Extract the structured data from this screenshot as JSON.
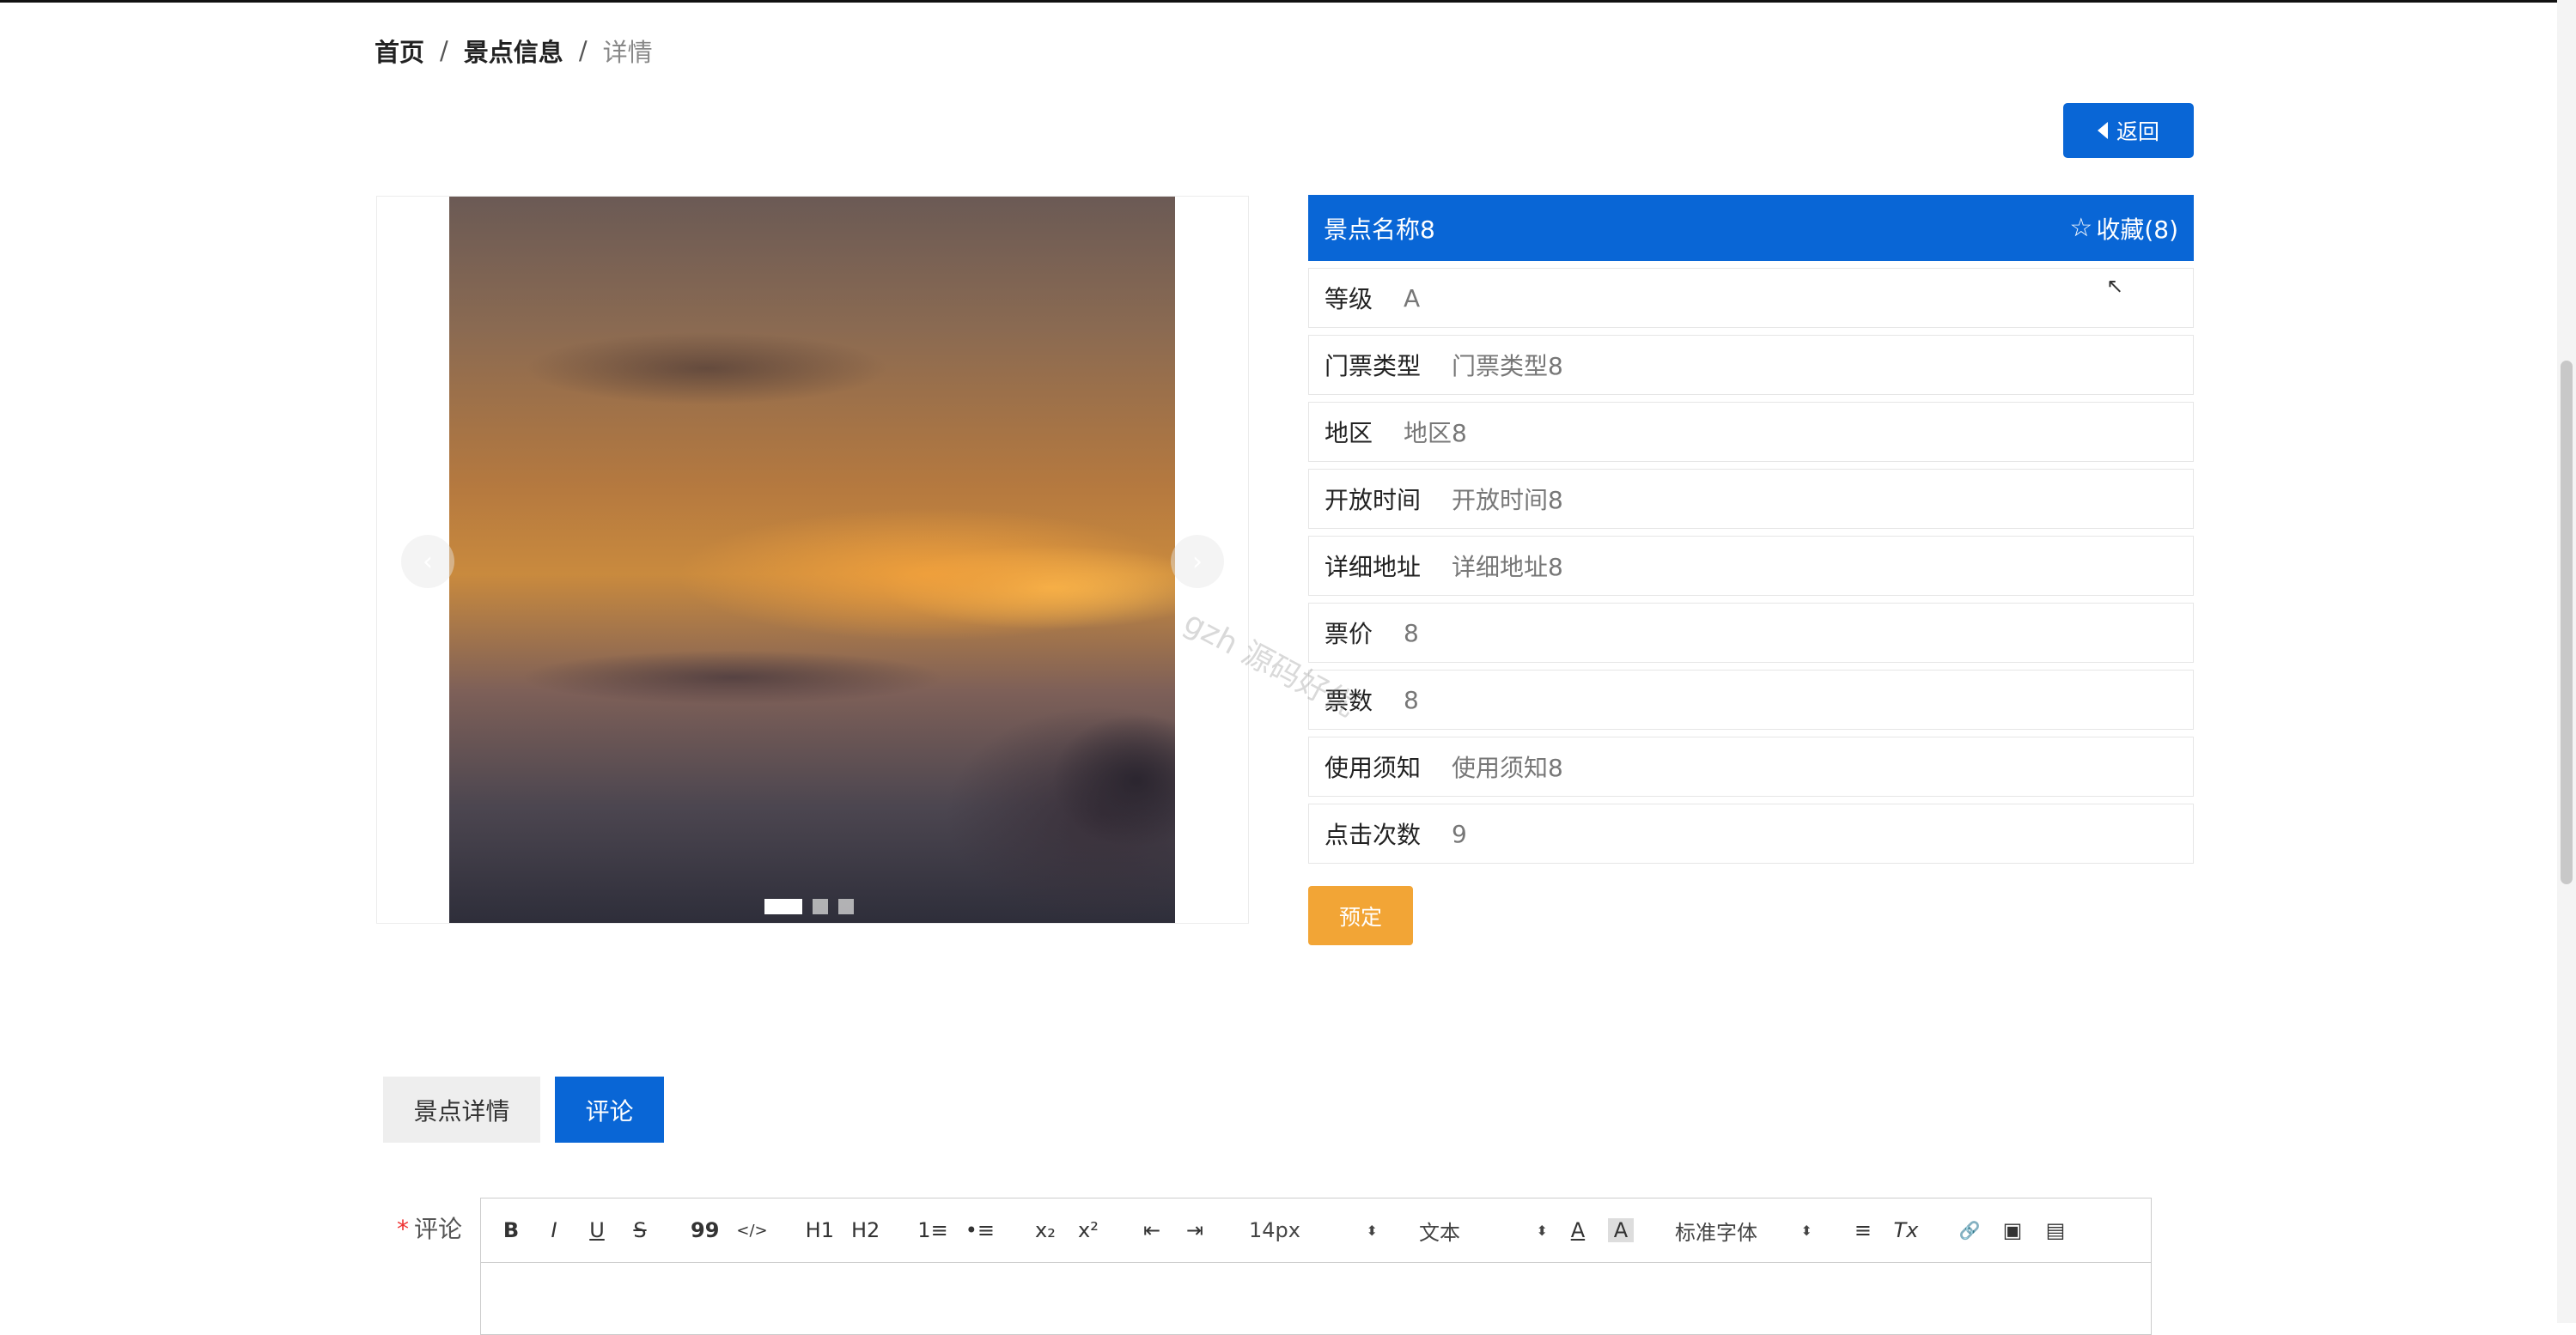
{
  "breadcrumb": {
    "home": "首页",
    "list": "景点信息",
    "current": "详情",
    "sep": "/"
  },
  "actions": {
    "back_label": "返回",
    "book_label": "预定"
  },
  "carousel": {
    "prev": "‹",
    "next": "›"
  },
  "spot": {
    "name": "景点名称8",
    "favorite_label": "收藏(8)",
    "fields": [
      {
        "label": "等级",
        "value": "A"
      },
      {
        "label": "门票类型",
        "value": "门票类型8"
      },
      {
        "label": "地区",
        "value": "地区8"
      },
      {
        "label": "开放时间",
        "value": "开放时间8"
      },
      {
        "label": "详细地址",
        "value": "详细地址8"
      },
      {
        "label": "票价",
        "value": "8"
      },
      {
        "label": "票数",
        "value": "8"
      },
      {
        "label": "使用须知",
        "value": "使用须知8"
      },
      {
        "label": "点击次数",
        "value": "9"
      }
    ]
  },
  "tabs": {
    "detail": "景点详情",
    "comment": "评论"
  },
  "comment": {
    "required_mark": "*",
    "label": "评论",
    "toolbar": {
      "bold": "B",
      "italic": "I",
      "underline": "U",
      "strike": "S",
      "quote": "99",
      "code": "</>",
      "h1": "H1",
      "h2": "H2",
      "ordered": "1≡",
      "bullet": "•≡",
      "sub": "x₂",
      "sup": "x²",
      "outdent": "⇤",
      "indent": "⇥",
      "size": "14px",
      "text_type": "文本",
      "font": "标准字体",
      "color": "A",
      "bg": "A",
      "align": "≡",
      "clean": "Tx",
      "link": "🔗",
      "image": "▣",
      "video": "▤"
    }
  },
  "watermark": "gzh 源码好优",
  "colors": {
    "primary": "#0966d6",
    "book": "#f2a536"
  }
}
